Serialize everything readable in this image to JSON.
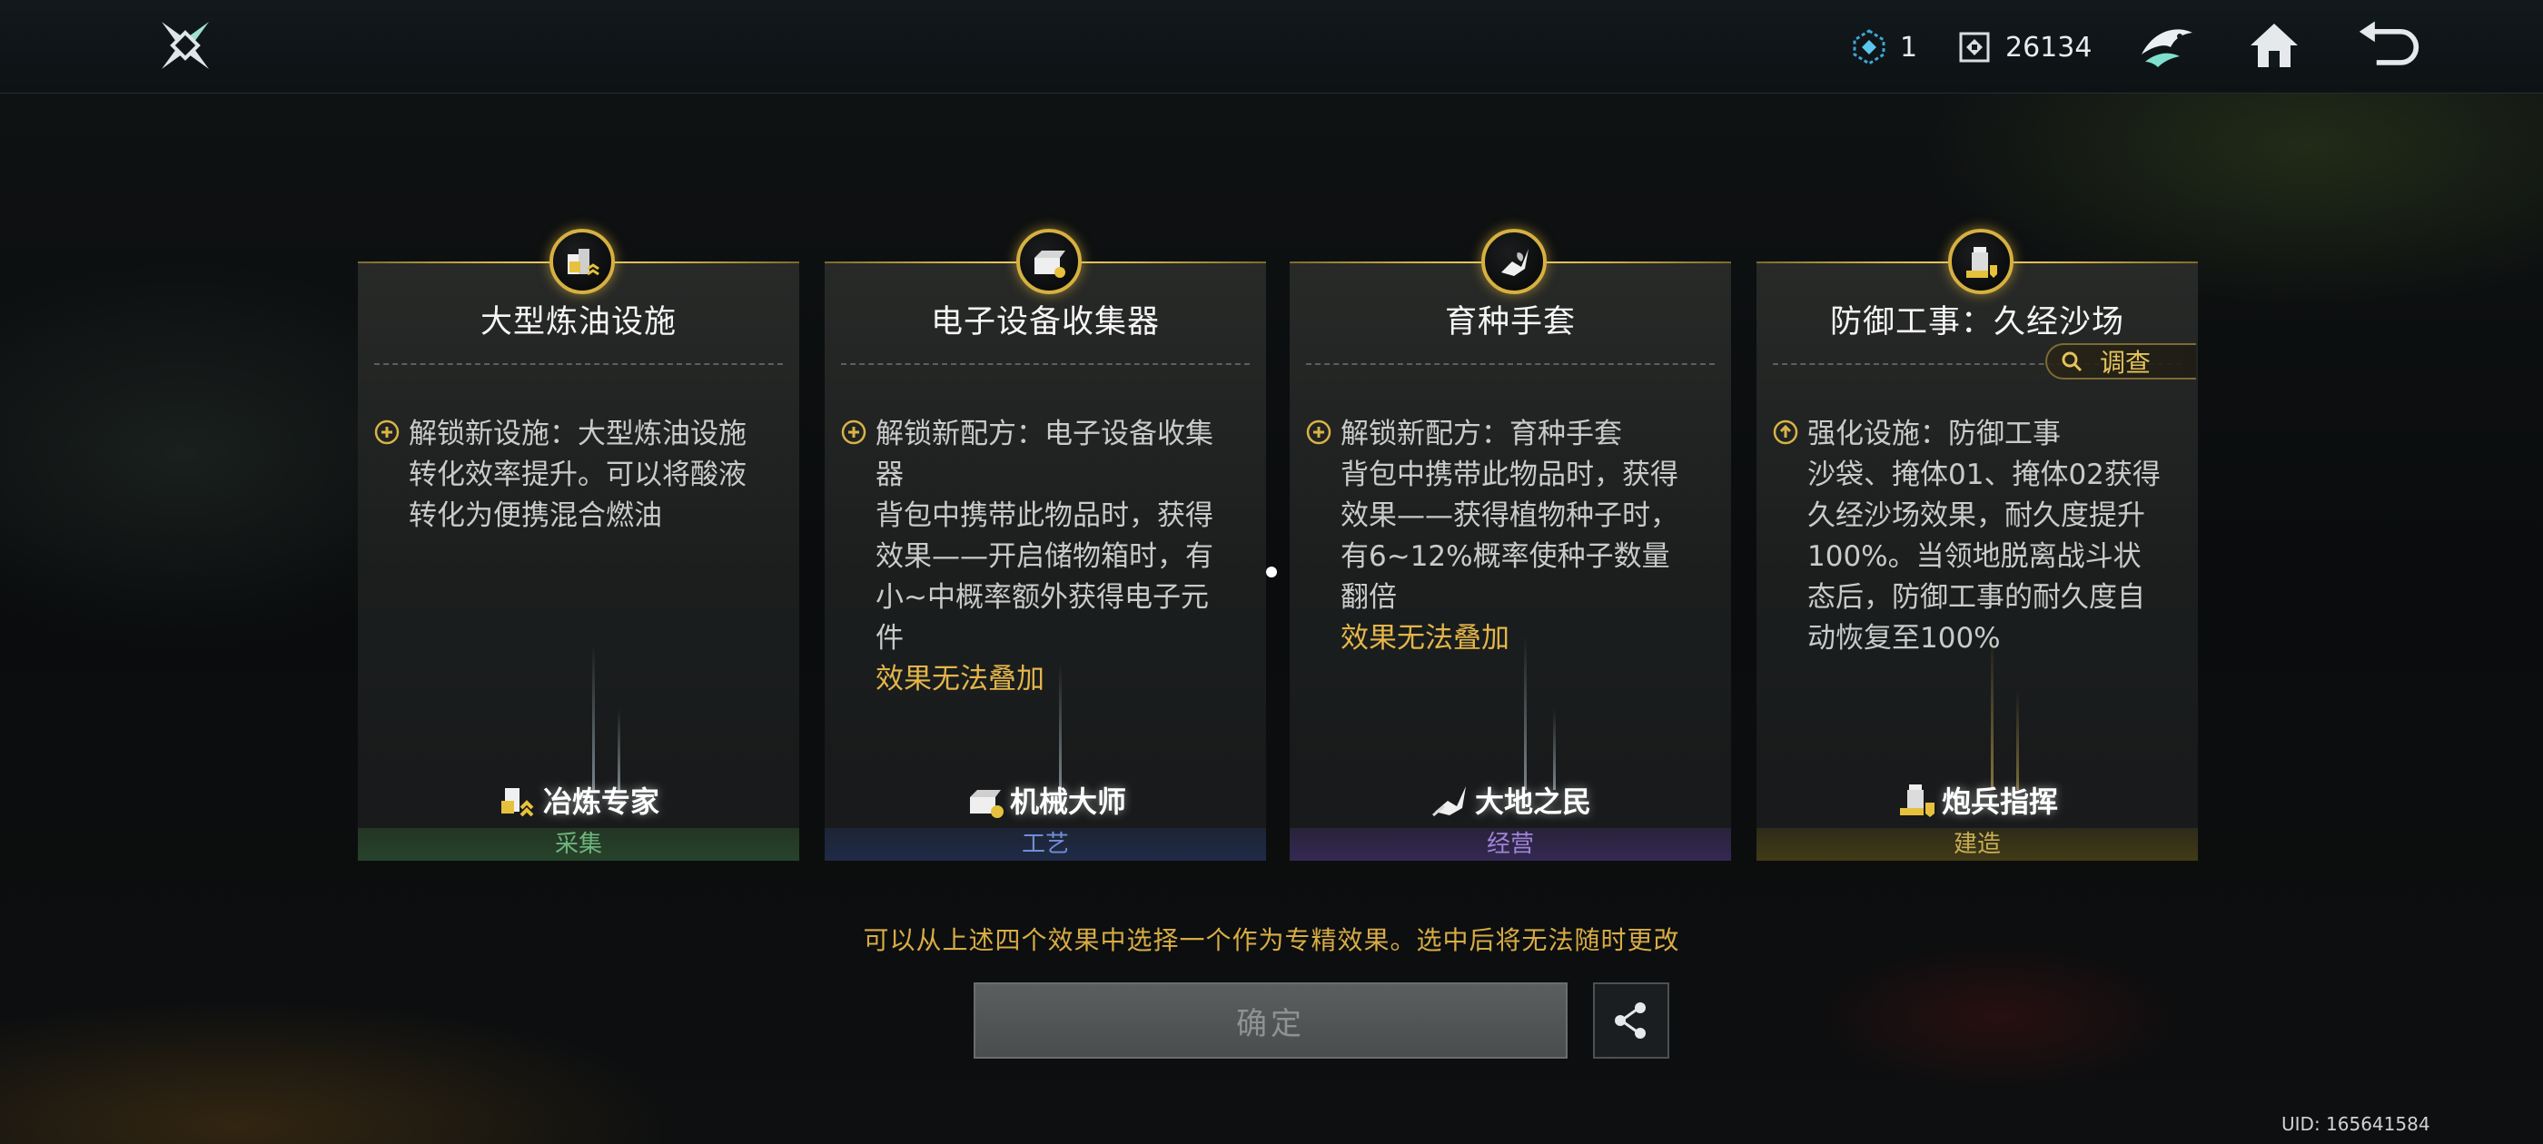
{
  "header": {
    "gems_count": "1",
    "coins_count": "26134",
    "icons": {
      "logo": "guild-logo-icon",
      "gems": "gem-icon",
      "coins": "coin-icon",
      "emblem": "eagle-emblem-icon",
      "home": "home-icon",
      "back": "back-arrow-icon"
    }
  },
  "cards": [
    {
      "title": "大型炼油设施",
      "effect_type": "unlock",
      "lines": [
        "解锁新设施：大型炼油设施",
        "转化效率提升。可以将酸液",
        "转化为便携混合燃油"
      ],
      "warning": "",
      "spec_name": "冶炼专家",
      "category": "采集",
      "category_color": "#6fb47c"
    },
    {
      "title": "电子设备收集器",
      "effect_type": "unlock",
      "lines": [
        "解锁新配方：电子设备收集",
        "器",
        "背包中携带此物品时，获得",
        "效果——开启储物箱时，有",
        "小~中概率额外获得电子元",
        "件"
      ],
      "warning": "效果无法叠加",
      "spec_name": "机械大师",
      "category": "工艺",
      "category_color": "#6f8fd6"
    },
    {
      "title": "育种手套",
      "effect_type": "unlock",
      "lines": [
        "解锁新配方：育种手套",
        "背包中携带此物品时，获得",
        "效果——获得植物种子时，",
        "有6~12%概率使种子数量",
        "翻倍"
      ],
      "warning": "效果无法叠加",
      "spec_name": "大地之民",
      "category": "经营",
      "category_color": "#9f84d8"
    },
    {
      "title": "防御工事：久经沙场",
      "effect_type": "upgrade",
      "lines": [
        "强化设施：防御工事",
        "沙袋、掩体01、掩体02获得",
        "久经沙场效果，耐久度提升",
        "100%。当领地脱离战斗状",
        "态后，防御工事的耐久度自",
        "动恢复至100%"
      ],
      "warning": "",
      "spec_name": "炮兵指挥",
      "category": "建造",
      "category_color": "#c8ae52",
      "investigate_label": "调查"
    }
  ],
  "hint": "可以从上述四个效果中选择一个作为专精效果。选中后将无法随时更改",
  "confirm_label": "确定",
  "share_icon": "share-icon",
  "uid": "UID: 165641584",
  "accent_color": "#d6b041"
}
